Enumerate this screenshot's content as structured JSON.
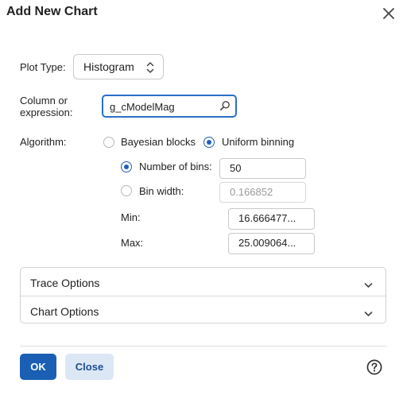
{
  "dialog": {
    "title": "Add New Chart",
    "close_icon": "close-icon"
  },
  "plot_type": {
    "label": "Plot Type:",
    "selected": "Histogram",
    "icon": "chevron-up-down-icon"
  },
  "column": {
    "label_line1": "Column or",
    "label_line2": "expression:",
    "value": "g_cModelMag",
    "icon": "search-icon"
  },
  "algorithm": {
    "label": "Algorithm:",
    "options": [
      {
        "label": "Bayesian blocks",
        "selected": false
      },
      {
        "label": "Uniform binning",
        "selected": true
      }
    ]
  },
  "binning": {
    "number_of_bins": {
      "label": "Number of bins:",
      "selected": true,
      "value": "50"
    },
    "bin_width": {
      "label": "Bin width:",
      "selected": false,
      "value": "0.166852"
    },
    "min": {
      "label": "Min:",
      "value": "16.666477..."
    },
    "max": {
      "label": "Max:",
      "value": "25.009064..."
    }
  },
  "sections": [
    {
      "label": "Trace Options",
      "icon": "chevron-down-icon"
    },
    {
      "label": "Chart Options",
      "icon": "chevron-down-icon"
    }
  ],
  "footer": {
    "ok_label": "OK",
    "close_label": "Close",
    "help_icon": "help-icon"
  },
  "colors": {
    "primary": "#1a5fb4",
    "focus_border": "#2a6fc9",
    "secondary_bg": "#dce7f5"
  }
}
